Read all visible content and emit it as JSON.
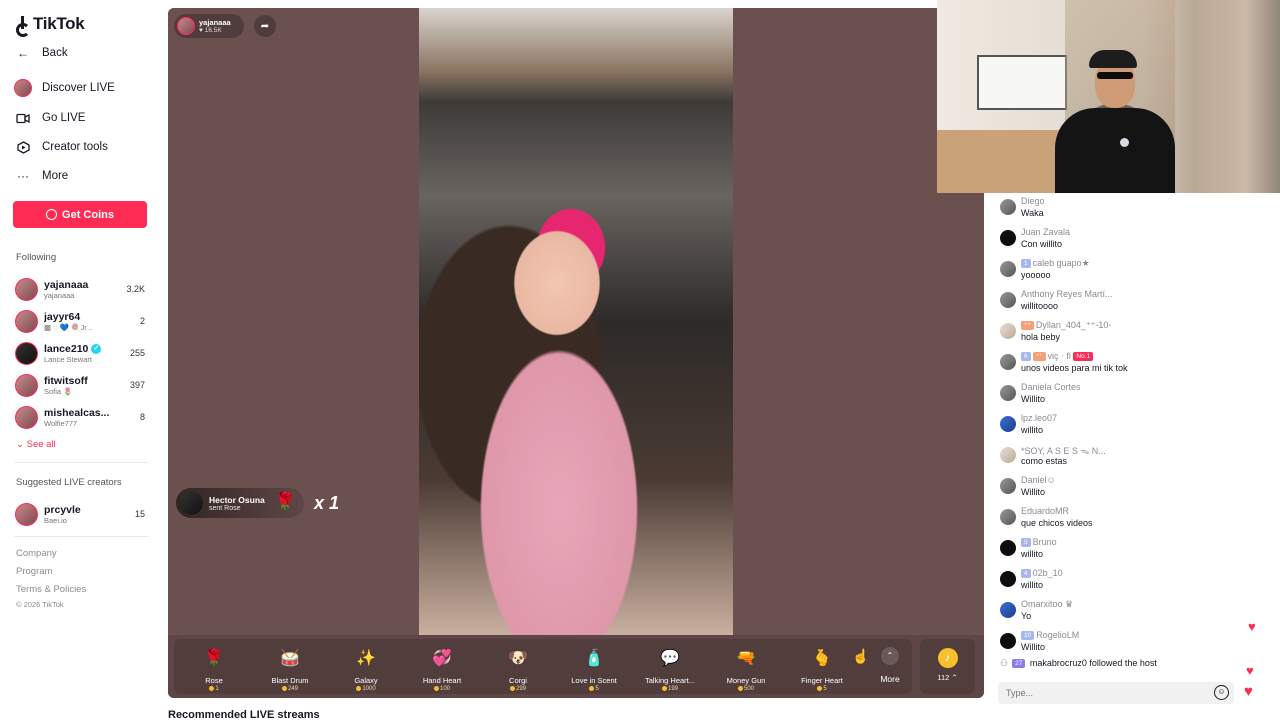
{
  "sidebar": {
    "logo": "TikTok",
    "back": "Back",
    "nav": [
      {
        "label": "Discover LIVE",
        "icon": "discover-live-icon"
      },
      {
        "label": "Go LIVE",
        "icon": "camera-icon"
      },
      {
        "label": "Creator tools",
        "icon": "creator-tools-icon"
      },
      {
        "label": "More",
        "icon": "more-icon"
      }
    ],
    "get_coins": "Get Coins",
    "following_title": "Following",
    "following": [
      {
        "name": "yajanaaa",
        "sub": "yajanaaa",
        "count": "3.2K"
      },
      {
        "name": "jayyr64",
        "sub": "▩ ◌ 💙 🍭Jr ..",
        "count": "2"
      },
      {
        "name": "lance210",
        "sub": "Lance Stewart",
        "count": "255",
        "verified": true
      },
      {
        "name": "fitwitsoff",
        "sub": "Sofia 🌷",
        "count": "397"
      },
      {
        "name": "mishealcas...",
        "sub": "Wolfie777",
        "count": "8"
      }
    ],
    "see_all": "See all",
    "suggested_title": "Suggested LIVE creators",
    "suggested": [
      {
        "name": "prcyvle",
        "sub": "Baei.io",
        "count": "15"
      }
    ],
    "footer": [
      "Company",
      "Program",
      "Terms & Policies"
    ],
    "copyright": "© 2026 TikTok"
  },
  "stream": {
    "host": {
      "name": "yajanaaa",
      "likes": "16.5K"
    },
    "gift_toast": {
      "name": "Hector Osuna",
      "action": "sent Rose",
      "combo": "x 1"
    },
    "gifts": [
      {
        "name": "Rose",
        "price": "1",
        "icon": "🌹"
      },
      {
        "name": "Blast Drum",
        "price": "249",
        "icon": "🥁"
      },
      {
        "name": "Galaxy",
        "price": "1000",
        "icon": "✨"
      },
      {
        "name": "Hand Heart",
        "price": "100",
        "icon": "💞"
      },
      {
        "name": "Corgi",
        "price": "299",
        "icon": "🐶"
      },
      {
        "name": "Love in Scent",
        "price": "5",
        "icon": "🧴"
      },
      {
        "name": "Talking Heart...",
        "price": "199",
        "icon": "💬"
      },
      {
        "name": "Money Gun",
        "price": "500",
        "icon": "🔫"
      },
      {
        "name": "Finger Heart",
        "price": "5",
        "icon": "🫰"
      }
    ],
    "more_label": "More",
    "coins": "112 ⌃"
  },
  "recommended_title": "Recommended LIVE streams",
  "chat": {
    "messages": [
      {
        "user": "Diego",
        "text": "Waka",
        "avatar": "gray"
      },
      {
        "user": "Juan Zavala",
        "text": "Con willito",
        "avatar": "black"
      },
      {
        "user": "caleb guapo★",
        "text": "yooooo",
        "avatar": "gray",
        "badges": [
          "1"
        ]
      },
      {
        "user": "Anthony Reyes Martí...",
        "text": "willitoooo",
        "avatar": "gray"
      },
      {
        "user": "Dyllan_404_⁺⁺-10-",
        "text": "hola beby",
        "avatar": "light",
        "badges": [
          "⁺⁺"
        ]
      },
      {
        "user": "viç ⋅ fl",
        "text": "unos videos para mi tik tok",
        "avatar": "gray",
        "badges": [
          "6",
          "⁺⁺"
        ],
        "red_badge": "No.1"
      },
      {
        "user": "Daniela Cortes",
        "text": "Willito",
        "avatar": "gray"
      },
      {
        "user": "lpz.leo07",
        "text": "willito",
        "avatar": "blue"
      },
      {
        "user": "*SOY, A S E S ᯓ N...",
        "text": "como estas",
        "avatar": "light"
      },
      {
        "user": "Daniel☺",
        "text": "Willito",
        "avatar": "gray"
      },
      {
        "user": "EduardoMR",
        "text": "que chicos videos",
        "avatar": "gray"
      },
      {
        "user": "Bruno",
        "text": "willito",
        "avatar": "black",
        "badges": [
          "5"
        ]
      },
      {
        "user": "02b_10",
        "text": "willito",
        "avatar": "black",
        "badges": [
          "4"
        ]
      },
      {
        "user": "Omarxitoo ♛",
        "text": "Yo",
        "avatar": "blue"
      },
      {
        "user": "RogelioLM",
        "text": "Willito",
        "avatar": "black",
        "badges": [
          "10"
        ]
      }
    ],
    "follow_note": {
      "badge": "27",
      "user": "makabrocruz0",
      "text": "followed the host"
    },
    "input_placeholder": "Type..."
  },
  "colors": {
    "accent": "#fe2c55",
    "stream_bg": "#6b5050",
    "coin": "#f5c02b"
  }
}
